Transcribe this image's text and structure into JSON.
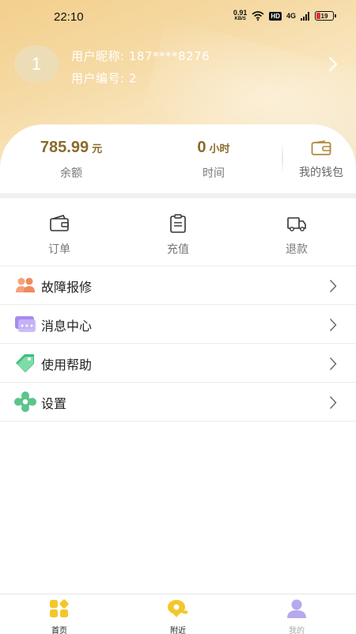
{
  "status_bar": {
    "time": "22:10",
    "net_speed": "0.91",
    "net_unit": "KB/S",
    "hd": "HD",
    "signal": "4G",
    "battery": "19"
  },
  "profile": {
    "avatar_text": "1",
    "nickname_line": "用户昵称: 187****8276",
    "id_line": "用户编号: 2"
  },
  "stats": {
    "balance_value": "785.99",
    "balance_unit": "元",
    "balance_label": "余额",
    "time_value": "0",
    "time_unit": "小时",
    "time_label": "时间",
    "wallet_label": "我的钱包"
  },
  "quick_actions": [
    {
      "label": "订单",
      "icon": "wallet-icon"
    },
    {
      "label": "充值",
      "icon": "clipboard-icon"
    },
    {
      "label": "退款",
      "icon": "truck-icon"
    }
  ],
  "menu": [
    {
      "label": "故障报修",
      "icon": "users-icon",
      "color": "#f08a5d"
    },
    {
      "label": "消息中心",
      "icon": "message-icon",
      "color": "#9b7fe0"
    },
    {
      "label": "使用帮助",
      "icon": "tag-icon",
      "color": "#4cc98a"
    },
    {
      "label": "设置",
      "icon": "flower-gear-icon",
      "color": "#5cc48c"
    }
  ],
  "bottom_nav": [
    {
      "label": "首页",
      "icon": "home-grid-icon",
      "active": true
    },
    {
      "label": "附近",
      "icon": "location-icon",
      "active": true
    },
    {
      "label": "我的",
      "icon": "person-icon",
      "active": false
    }
  ],
  "colors": {
    "accent_gold": "#8a6a2a",
    "icon_yellow": "#f3c72a",
    "icon_purple": "#b7a8ef"
  }
}
